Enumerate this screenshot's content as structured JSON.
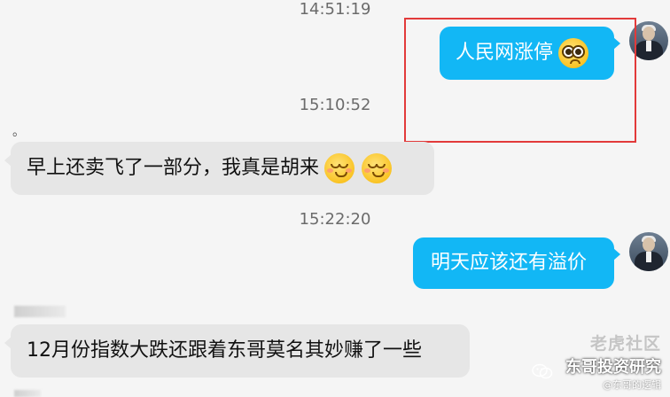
{
  "timestamps": [
    "14:51:19",
    "15:10:52",
    "15:22:20"
  ],
  "messages": [
    {
      "side": "right",
      "text": "人民网涨停",
      "emoji": [
        "pleading-face"
      ]
    },
    {
      "side": "left",
      "text": "早上还卖飞了一部分，我真是胡来",
      "emoji": [
        "relieved-face",
        "relieved-face"
      ]
    },
    {
      "side": "right",
      "text": "明天应该还有溢价"
    },
    {
      "side": "left",
      "text": "12月份指数大跌还跟着东哥莫名其妙赚了一些"
    }
  ],
  "dot_mark": "。",
  "watermark": {
    "top": "老虎社区",
    "main": "东哥投资研究",
    "sub": "@东哥的逻辑"
  },
  "colors": {
    "outgoing_bubble": "#12b7f5",
    "incoming_bubble": "#e6e6e6",
    "highlight_box": "#e23a3a",
    "background": "#f5f5f5"
  }
}
